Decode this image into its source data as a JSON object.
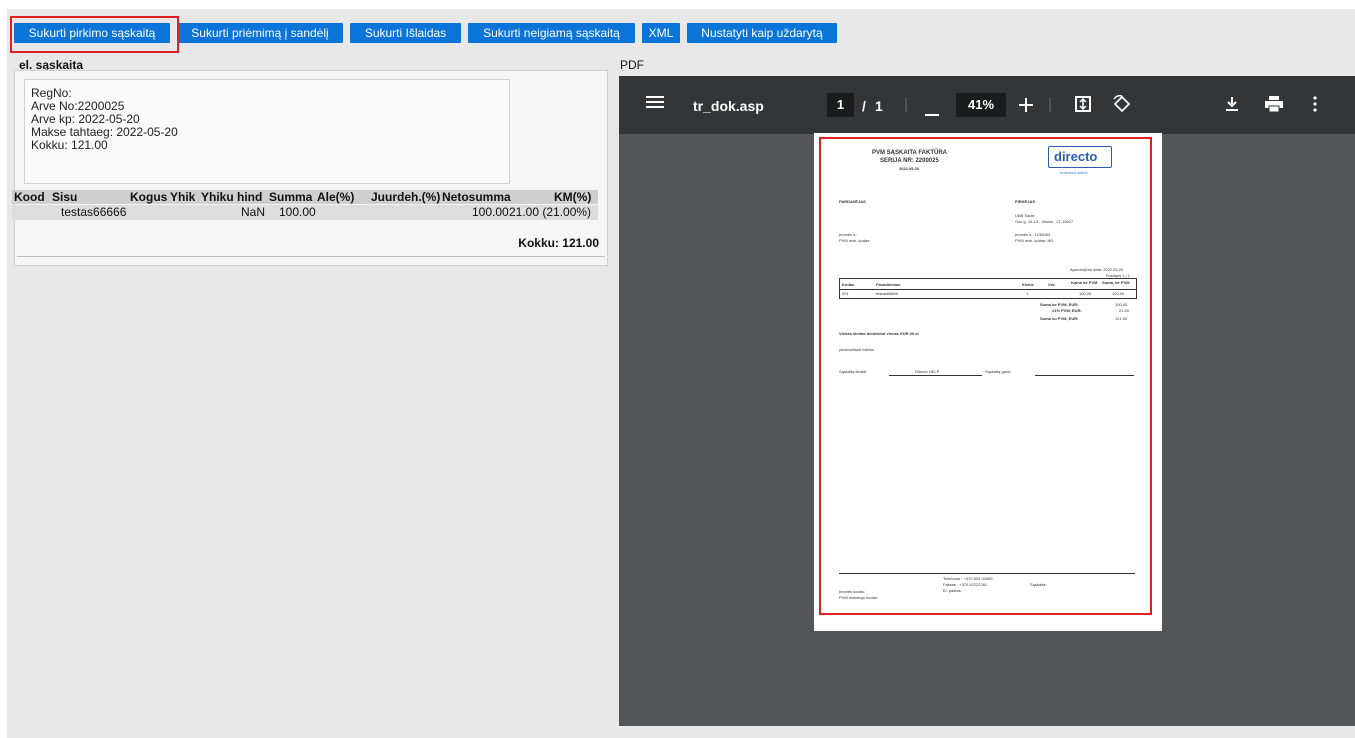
{
  "toolbar": {
    "buttons": [
      "Sukurti pirkimo sąskaitą",
      "Sukurti priėmimą į sandėlį",
      "Sukurti Išlaidas",
      "Sukurti neigiamą sąskaitą",
      "XML",
      "Nustatyti kaip uždarytą"
    ],
    "highlighted_button": "Sukurti pirkimo sąskaitą"
  },
  "einvoice": {
    "title": "el. sąskaita",
    "header_lines": [
      "RegNo:",
      "Arve No:2200025",
      "Arve kp: 2022-05-20",
      "Makse tahtaeg: 2022-05-20",
      "Kokku: 121.00"
    ],
    "columns": [
      "Kood",
      "Sisu",
      "Kogus",
      "Yhik",
      "Yhiku hind",
      "Summa",
      "Ale(%)",
      "Juurdeh.(%)",
      "Netosumma",
      "KM(%)"
    ],
    "rows": [
      {
        "kood": "",
        "sisu": "testas66666",
        "kogus": "",
        "yhik": "",
        "yhiku_hind": "NaN",
        "summa": "100.00",
        "ale": "",
        "juurdeh": "",
        "netosumma": "100.00",
        "km": "21.00 (21.00%)"
      }
    ],
    "total": "Kokku: 121.00"
  },
  "pdf": {
    "title": "PDF",
    "file_name": "tr_dok.asp",
    "current_page": "1",
    "page_sep": "/",
    "total_pages": "1",
    "zoom": "41%",
    "icons": [
      "menu-icon",
      "zoom-out-icon",
      "zoom-in-icon",
      "fit-page-icon",
      "rotate-icon",
      "download-icon",
      "print-icon",
      "more-icon"
    ],
    "document": {
      "title": "PVM SĄSKAITA FAKTŪRA",
      "series": "SERIJA  NR: 2200025",
      "date": "2022.05.20",
      "logo": "directo",
      "logo_sub": "business online",
      "seller_label": "PARDAVĖJAS",
      "buyer_label": "PIRKĖJAS",
      "buyer_name": "UAB Saule",
      "buyer_address": "Ozo g. 16-13 , Vilnius , LT-10607",
      "seller_code": "Įmonės k.:",
      "seller_vat": "PVM mok. kodas:",
      "buyer_code": "Įmonės k.: 1236083",
      "buyer_vat": "PVM mok. kodas: ND",
      "payment_date": "Apmokėjimo data: 2022.05.20",
      "page_info": "Puslapis 1 / 1",
      "table_headers": [
        "Kodas",
        "Pavadinimas",
        "Kiekis",
        "Vnt.",
        "Kaina be PVM",
        "Suma, be PVM"
      ],
      "table_row": [
        "001",
        "testas66666",
        "1",
        "",
        "100.00",
        "100.00"
      ],
      "sum_rows": [
        {
          "label": "Suma be PVM, EUR:",
          "value": "100.00"
        },
        {
          "label": "21% PVM, EUR:",
          "value": "21.00"
        },
        {
          "label": "Suma su PVM, EUR:",
          "value": "121.00"
        }
      ],
      "words": "Vienas šimtas dvidešimt vienas  EUR  00 ct",
      "note": "pensiozūsuti kainos",
      "issued_label": "Sąskaitą išrašė:",
      "issued_by": "Directo HELP",
      "received_label": "Sąskaitą gavo:",
      "footer_phone": "Telefonas : +370 603 00050",
      "footer_fax": "Faksas : +370 52222261",
      "footer_email": "El. paštas:",
      "footer_account": "Sąskaita:",
      "footer_company_code": "Įmonės kodas:",
      "footer_vat_code": "PVM mokėtojo kodas:"
    }
  },
  "colors": {
    "button_blue": "#0a74d8",
    "highlight_red": "#e02020",
    "viewer_bg": "#525659",
    "viewer_toolbar": "#323639"
  }
}
